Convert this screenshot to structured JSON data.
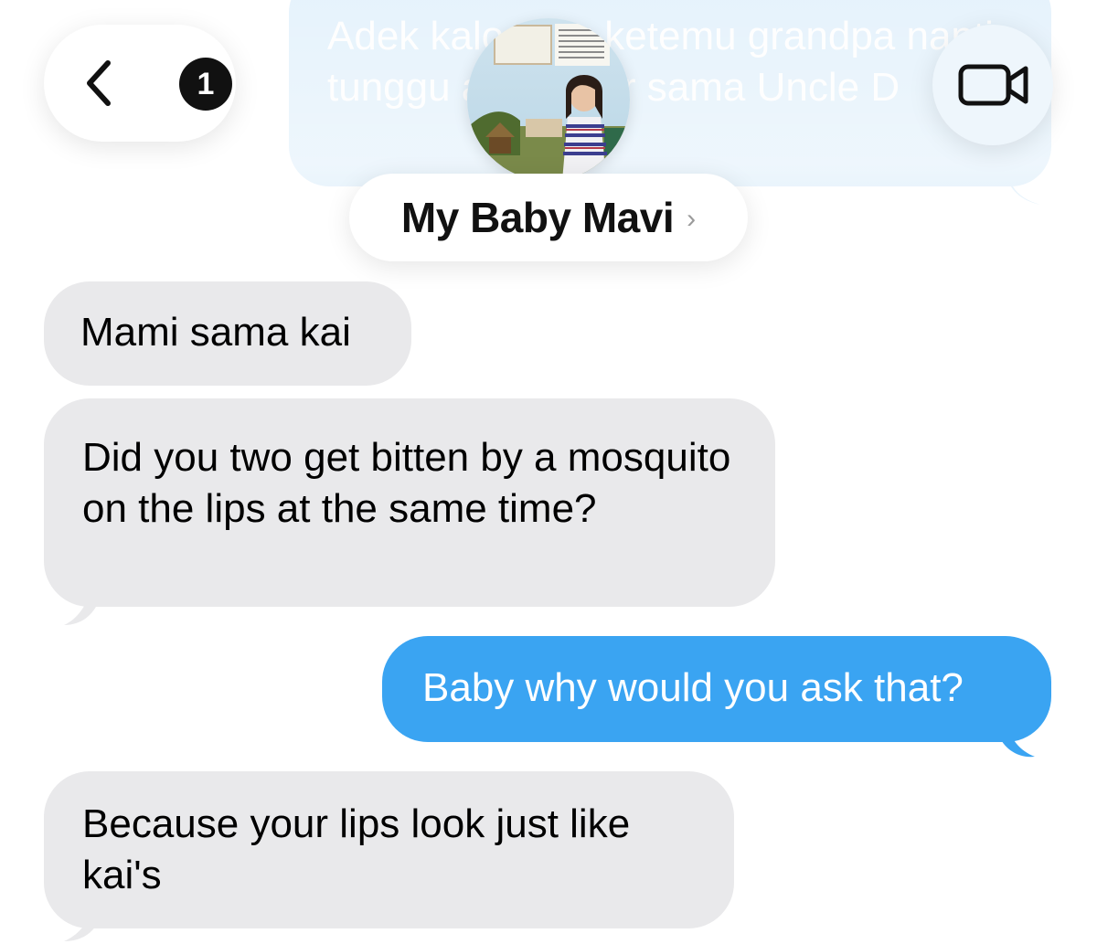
{
  "header": {
    "back_badge_count": "1",
    "contact_name": "My Baby Mavi",
    "contact_chevron": "›"
  },
  "messages": [
    {
      "direction": "outgoing",
      "text": "Adek kalo mau ketemu grandpa nanti tunggu aja di luar sama Uncle D",
      "faded": true
    },
    {
      "direction": "incoming",
      "text": "Mami sama kai"
    },
    {
      "direction": "incoming",
      "text": "Did you two get bitten by a mosquito on the lips at the same time?"
    },
    {
      "direction": "outgoing",
      "text": "Baby why would you ask that?"
    },
    {
      "direction": "incoming",
      "text": "Because your lips look just like kai's"
    }
  ],
  "colors": {
    "incoming_bubble": "#e9e9eb",
    "outgoing_bubble": "#3aa4f2",
    "faded_outgoing_bubble": "#d9ecfa"
  },
  "icons": {
    "back": "chevron-left-icon",
    "video": "video-camera-icon"
  }
}
